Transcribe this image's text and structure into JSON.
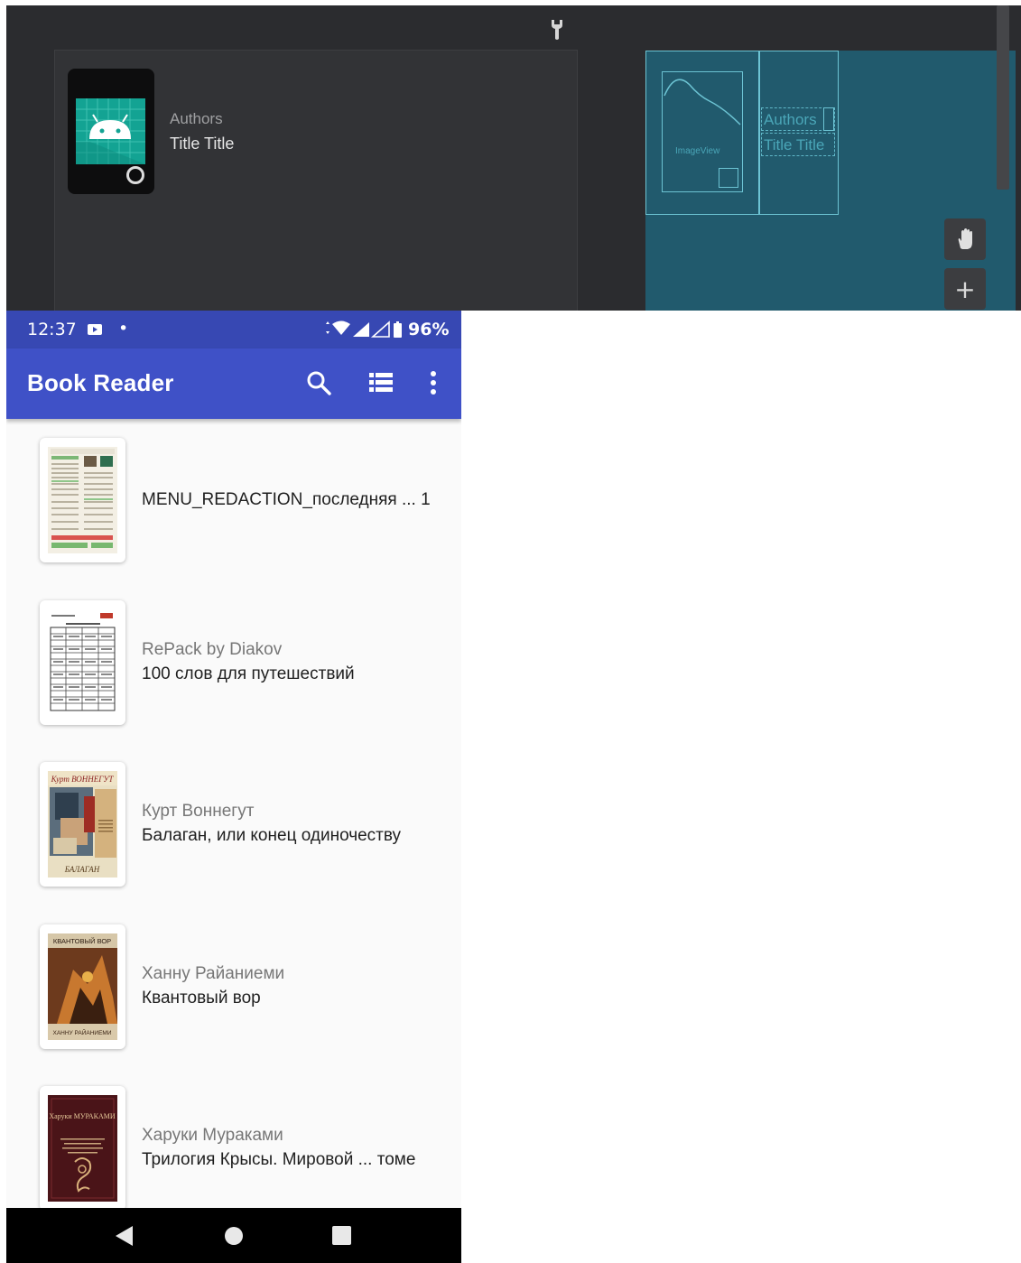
{
  "preview": {
    "authors_label": "Authors",
    "title_label": "Title Title",
    "blueprint": {
      "image_label": "ImageView",
      "authors_label": "Authors",
      "title_label": "Title Title"
    },
    "tools": {
      "pan_icon": "hand-icon",
      "zoom_in_icon": "plus-icon",
      "zoom_in_glyph": "+"
    },
    "accent": "#13a393"
  },
  "status_bar": {
    "time": "12:37",
    "dot": "•",
    "battery": "96%",
    "color": "#3748b3"
  },
  "app_bar": {
    "title": "Book Reader",
    "color": "#3f51c7",
    "icons": [
      "search-icon",
      "list-view-icon",
      "more-vert-icon"
    ]
  },
  "books": [
    {
      "author": "",
      "title": "MENU_REDACTION_последняя ... 1"
    },
    {
      "author": "RePack by Diakov",
      "title": "100 слов для путешествий"
    },
    {
      "author": "Курт Воннегут",
      "title": "Балаган, или конец одиночеству"
    },
    {
      "author": "Ханну Райаниеми",
      "title": "Квантовый вор"
    },
    {
      "author": "Харуки Мураками",
      "title": "Трилогия Крысы. Мировой ... томе"
    }
  ],
  "covers": {
    "c2_header": "Курт ВОННЕГУТ",
    "c2_footer": "БАЛАГАН",
    "c3_header": "КВАНТОВЫЙ ВОР",
    "c3_footer": "ХАННУ РАЙАНИЕМИ",
    "c4_header": "Харуки МУРАКАМИ"
  },
  "nav_bar": {
    "icons": [
      "back-triangle-icon",
      "home-circle-icon",
      "recents-square-icon"
    ]
  }
}
